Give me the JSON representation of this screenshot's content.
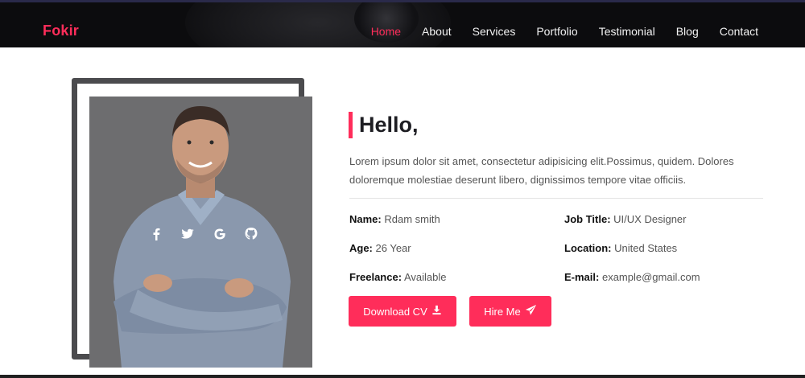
{
  "brand": {
    "name": "Fokir"
  },
  "nav": {
    "items": [
      {
        "label": "Home",
        "active": true
      },
      {
        "label": "About",
        "active": false
      },
      {
        "label": "Services",
        "active": false
      },
      {
        "label": "Portfolio",
        "active": false
      },
      {
        "label": "Testimonial",
        "active": false
      },
      {
        "label": "Blog",
        "active": false
      },
      {
        "label": "Contact",
        "active": false
      }
    ]
  },
  "profile": {
    "socials": [
      "facebook-icon",
      "twitter-icon",
      "google-icon",
      "github-icon"
    ]
  },
  "about": {
    "heading": "Hello,",
    "description": "Lorem ipsum dolor sit amet, consectetur adipisicing elit.Possimus, quidem. Dolores doloremque molestiae deserunt libero, dignissimos tempore vitae officiis.",
    "info": {
      "name_label": "Name:",
      "name_value": "Rdam smith",
      "age_label": "Age:",
      "age_value": "26 Year",
      "freelance_label": "Freelance:",
      "freelance_value": "Available",
      "job_label": "Job Title:",
      "job_value": "UI/UX Designer",
      "location_label": "Location:",
      "location_value": "United States",
      "email_label": "E-mail:",
      "email_value": "example@gmail.com"
    },
    "buttons": {
      "download_cv": "Download CV",
      "hire_me": "Hire Me"
    }
  },
  "colors": {
    "accent": "#ff2d5a",
    "navbar": "#0c0c0e",
    "frame": "#4b4b4e",
    "photo_bg": "#6d6d6f"
  }
}
